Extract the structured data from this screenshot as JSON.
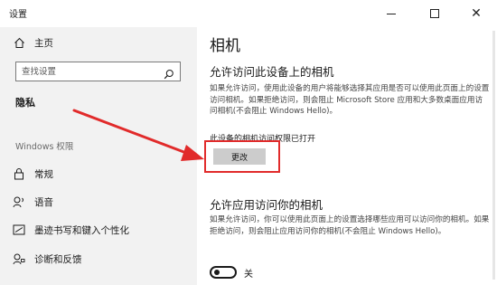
{
  "window": {
    "title": "设置"
  },
  "sidebar": {
    "home_label": "主页",
    "search_placeholder": "查找设置",
    "privacy_heading": "隐私",
    "section_label": "Windows 权限",
    "items": [
      {
        "label": "常规",
        "icon": "lock-icon"
      },
      {
        "label": "语音",
        "icon": "speech-icon"
      },
      {
        "label": "墨迹书写和键入个性化",
        "icon": "pen-icon"
      },
      {
        "label": "诊断和反馈",
        "icon": "feedback-icon"
      }
    ]
  },
  "main": {
    "title": "相机",
    "section1": {
      "heading": "允许访问此设备上的相机",
      "description": "如果允许访问，使用此设备的用户将能够选择其应用是否可以使用此页面上的设置访问相机。如果拒绝访问，则会阻止 Microsoft Store 应用和大多数桌面应用访问相机(不会阻止 Windows Hello)。",
      "status": "此设备的相机访问权限已打开",
      "change_button": "更改"
    },
    "section2": {
      "heading": "允许应用访问你的相机",
      "description": "如果允许访问，你可以使用此页面上的设置选择哪些应用可以访问你的相机。如果拒绝访问，则会阻止应用访问你的相机(不会阻止 Windows Hello)。",
      "toggle_state": "关"
    }
  },
  "colors": {
    "sidebar_bg": "#f2f2f2",
    "highlight": "#e12b2b",
    "button_bg": "#cccccc"
  }
}
